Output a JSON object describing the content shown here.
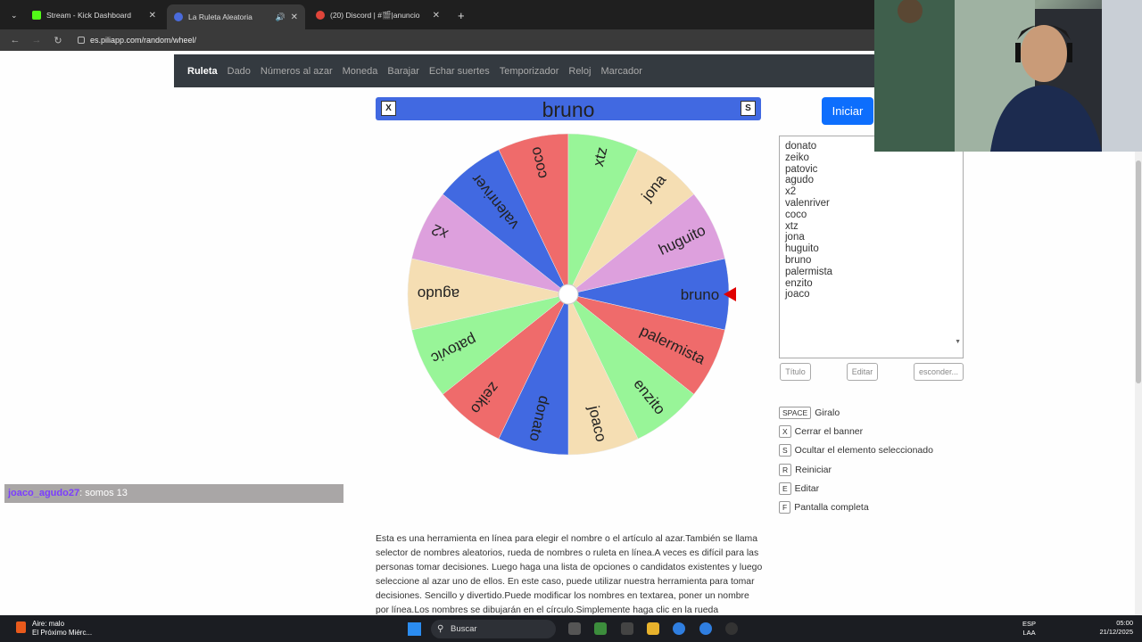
{
  "browser": {
    "tabs": [
      {
        "title": "Stream - Kick Dashboard",
        "color": "#53fc18"
      },
      {
        "title": "La Ruleta Aleatoria",
        "color": "#4a6bdc"
      },
      {
        "title": "(20) Discord | #🎬|anuncio",
        "color": "#5865f2"
      }
    ],
    "url": "es.piliapp.com/random/wheel/"
  },
  "sitenav": [
    "Ruleta",
    "Dado",
    "Números al azar",
    "Moneda",
    "Barajar",
    "Echar suertes",
    "Temporizador",
    "Reloj",
    "Marcador"
  ],
  "banner": {
    "title": "bruno",
    "left_btn": "X",
    "right_btn": "S"
  },
  "start_label": "Iniciar",
  "wheel": {
    "pointer_color": "#e00000",
    "segments": [
      {
        "label": "bruno",
        "color": "#4169e1"
      },
      {
        "label": "palermista",
        "color": "#ef6b6b"
      },
      {
        "label": "enzito",
        "color": "#98f598"
      },
      {
        "label": "joaco",
        "color": "#f5deb3"
      },
      {
        "label": "donato",
        "color": "#4169e1"
      },
      {
        "label": "zeiko",
        "color": "#ef6b6b"
      },
      {
        "label": "patovic",
        "color": "#98f598"
      },
      {
        "label": "agudo",
        "color": "#f5deb3"
      },
      {
        "label": "x2",
        "color": "#dda0dd"
      },
      {
        "label": "valenriver",
        "color": "#4169e1"
      },
      {
        "label": "coco",
        "color": "#ef6b6b"
      },
      {
        "label": "xtz",
        "color": "#98f598"
      },
      {
        "label": "jona",
        "color": "#f5deb3"
      },
      {
        "label": "huguito",
        "color": "#dda0dd"
      }
    ]
  },
  "names_list": [
    "donato",
    "zeiko",
    "patovic",
    "agudo",
    "x2",
    "valenriver",
    "coco",
    "xtz",
    "jona",
    "huguito",
    "bruno",
    "palermista",
    "enzito",
    "joaco"
  ],
  "buttons": {
    "title": "Título",
    "edit": "Editar",
    "hide": "esconder..."
  },
  "shortcuts": [
    {
      "key": "SPACE",
      "label": "Giralo"
    },
    {
      "key": "X",
      "label": "Cerrar el banner"
    },
    {
      "key": "S",
      "label": "Ocultar el elemento seleccionado"
    },
    {
      "key": "R",
      "label": "Reiniciar"
    },
    {
      "key": "E",
      "label": "Editar"
    },
    {
      "key": "F",
      "label": "Pantalla completa"
    }
  ],
  "description": "Esta es una herramienta en línea para elegir el nombre o el artículo al azar.También se llama selector de nombres aleatorios, rueda de nombres o ruleta en línea.A veces es difícil para las personas tomar decisiones. Luego haga una lista de opciones o candidatos existentes y luego seleccione al azar uno de ellos. En este caso, puede utilizar nuestra herramienta para tomar decisiones. Sencillo y divertido.Puede modificar los nombres en textarea, poner un nombre por línea.Los nombres se dibujarán en el círculo.Simplemente haga clic en la rueda",
  "chat": {
    "user": "joaco_agudo27",
    "message": ": somos 13"
  },
  "taskbar": {
    "weather_title": "Aire: malo",
    "weather_sub": "El Próximo Miérc...",
    "search": "Buscar",
    "lang_top": "ESP",
    "lang_bottom": "LAA",
    "time": "05:00",
    "date": "21/12/2025"
  }
}
